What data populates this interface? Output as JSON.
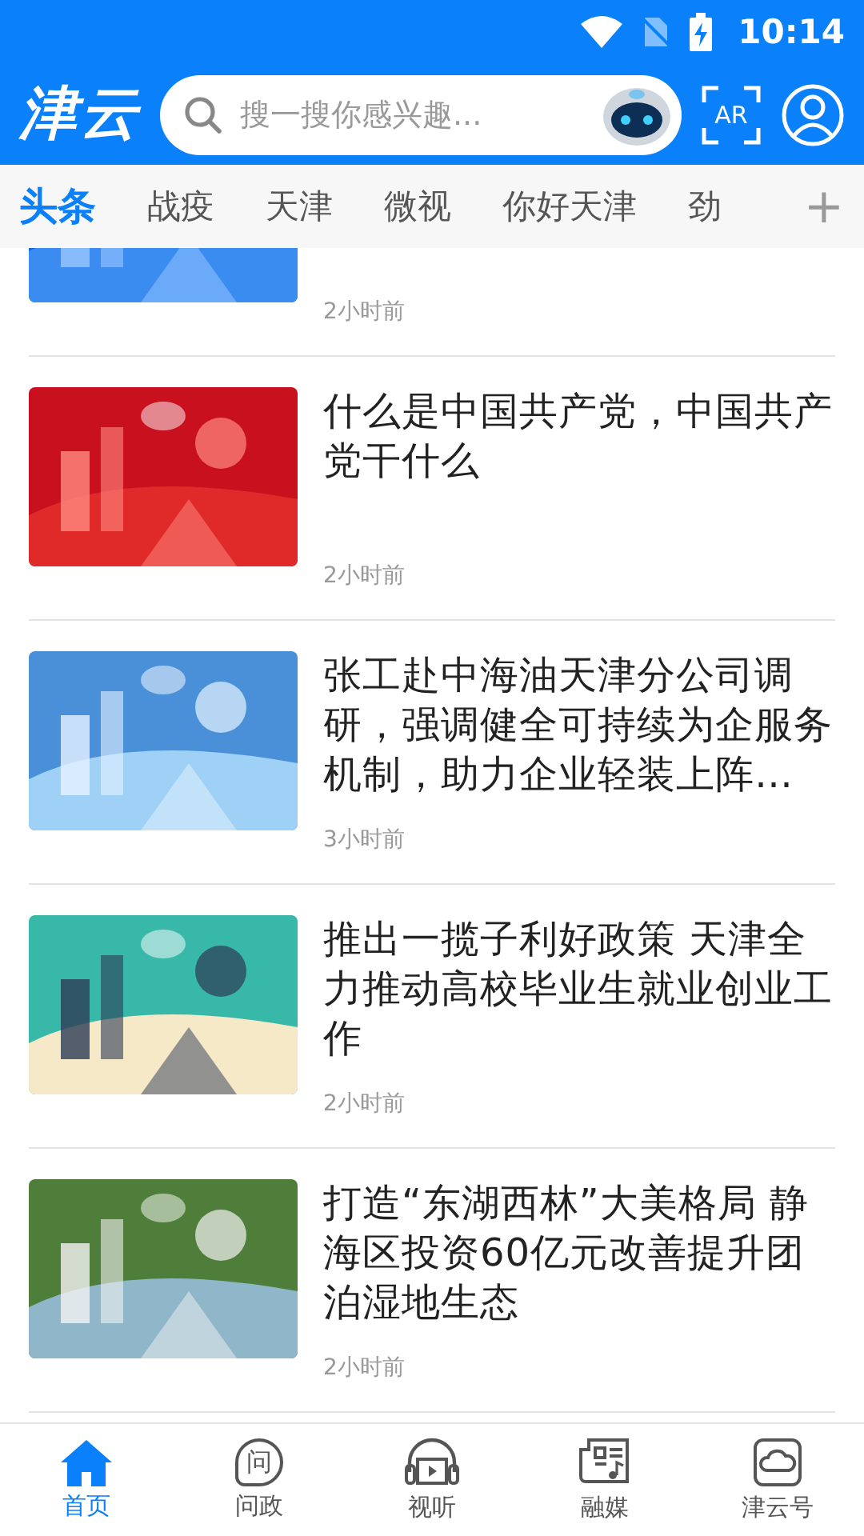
{
  "status_bar": {
    "time": "10:14"
  },
  "header": {
    "logo": "津云",
    "search": {
      "placeholder": "搜一搜你感兴趣..."
    },
    "ar_label": "AR"
  },
  "tabs": [
    {
      "label": "头条",
      "selected": true
    },
    {
      "label": "战疫",
      "selected": false
    },
    {
      "label": "天津",
      "selected": false
    },
    {
      "label": "微视",
      "selected": false
    },
    {
      "label": "你好天津",
      "selected": false
    },
    {
      "label": "劲",
      "selected": false
    }
  ],
  "add_tab": "+",
  "articles": [
    {
      "time": "2小时前"
    },
    {
      "title": "什么是中国共产党，中国共产党干什么",
      "time": "2小时前"
    },
    {
      "title": "张工赴中海油天津分公司调研，强调健全可持续为企服务机制，助力企业轻装上阵…",
      "time": "3小时前"
    },
    {
      "title": "推出一揽子利好政策 天津全力推动高校毕业生就业创业工作",
      "time": "2小时前"
    },
    {
      "title": "打造“东湖西林”大美格局 静海区投资60亿元改善提升团泊湿地生态",
      "time": "2小时前"
    }
  ],
  "bottom_nav": [
    {
      "label": "首页",
      "kind": "home",
      "selected": true
    },
    {
      "label": "问政",
      "kind": "ask",
      "glyph": "问",
      "selected": false
    },
    {
      "label": "视听",
      "kind": "media",
      "selected": false
    },
    {
      "label": "融媒",
      "kind": "news",
      "selected": false
    },
    {
      "label": "津云号",
      "kind": "cloud",
      "selected": false
    }
  ]
}
